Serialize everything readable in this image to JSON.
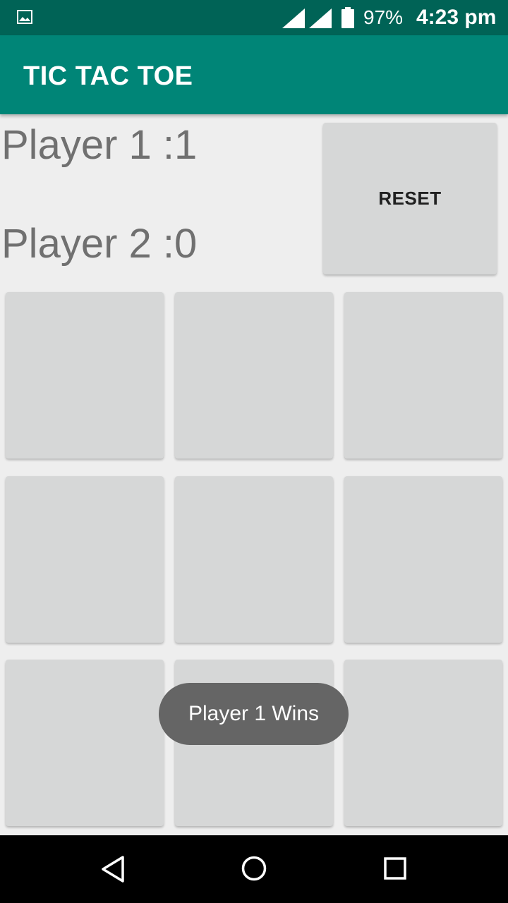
{
  "status_bar": {
    "battery": "97%",
    "time": "4:23 pm",
    "icons": [
      "image-icon",
      "signal-icon",
      "signal-icon",
      "battery-icon"
    ]
  },
  "app_bar": {
    "title": "TIC TAC TOE",
    "color": "#008577"
  },
  "scores": {
    "player1": "Player 1 :1",
    "player2": "Player 2 :0"
  },
  "reset_label": "RESET",
  "board": {
    "cells": [
      "",
      "",
      "",
      "",
      "",
      "",
      "",
      "",
      ""
    ]
  },
  "toast": "Player 1 Wins",
  "nav": [
    "back-icon",
    "home-icon",
    "recents-icon"
  ]
}
